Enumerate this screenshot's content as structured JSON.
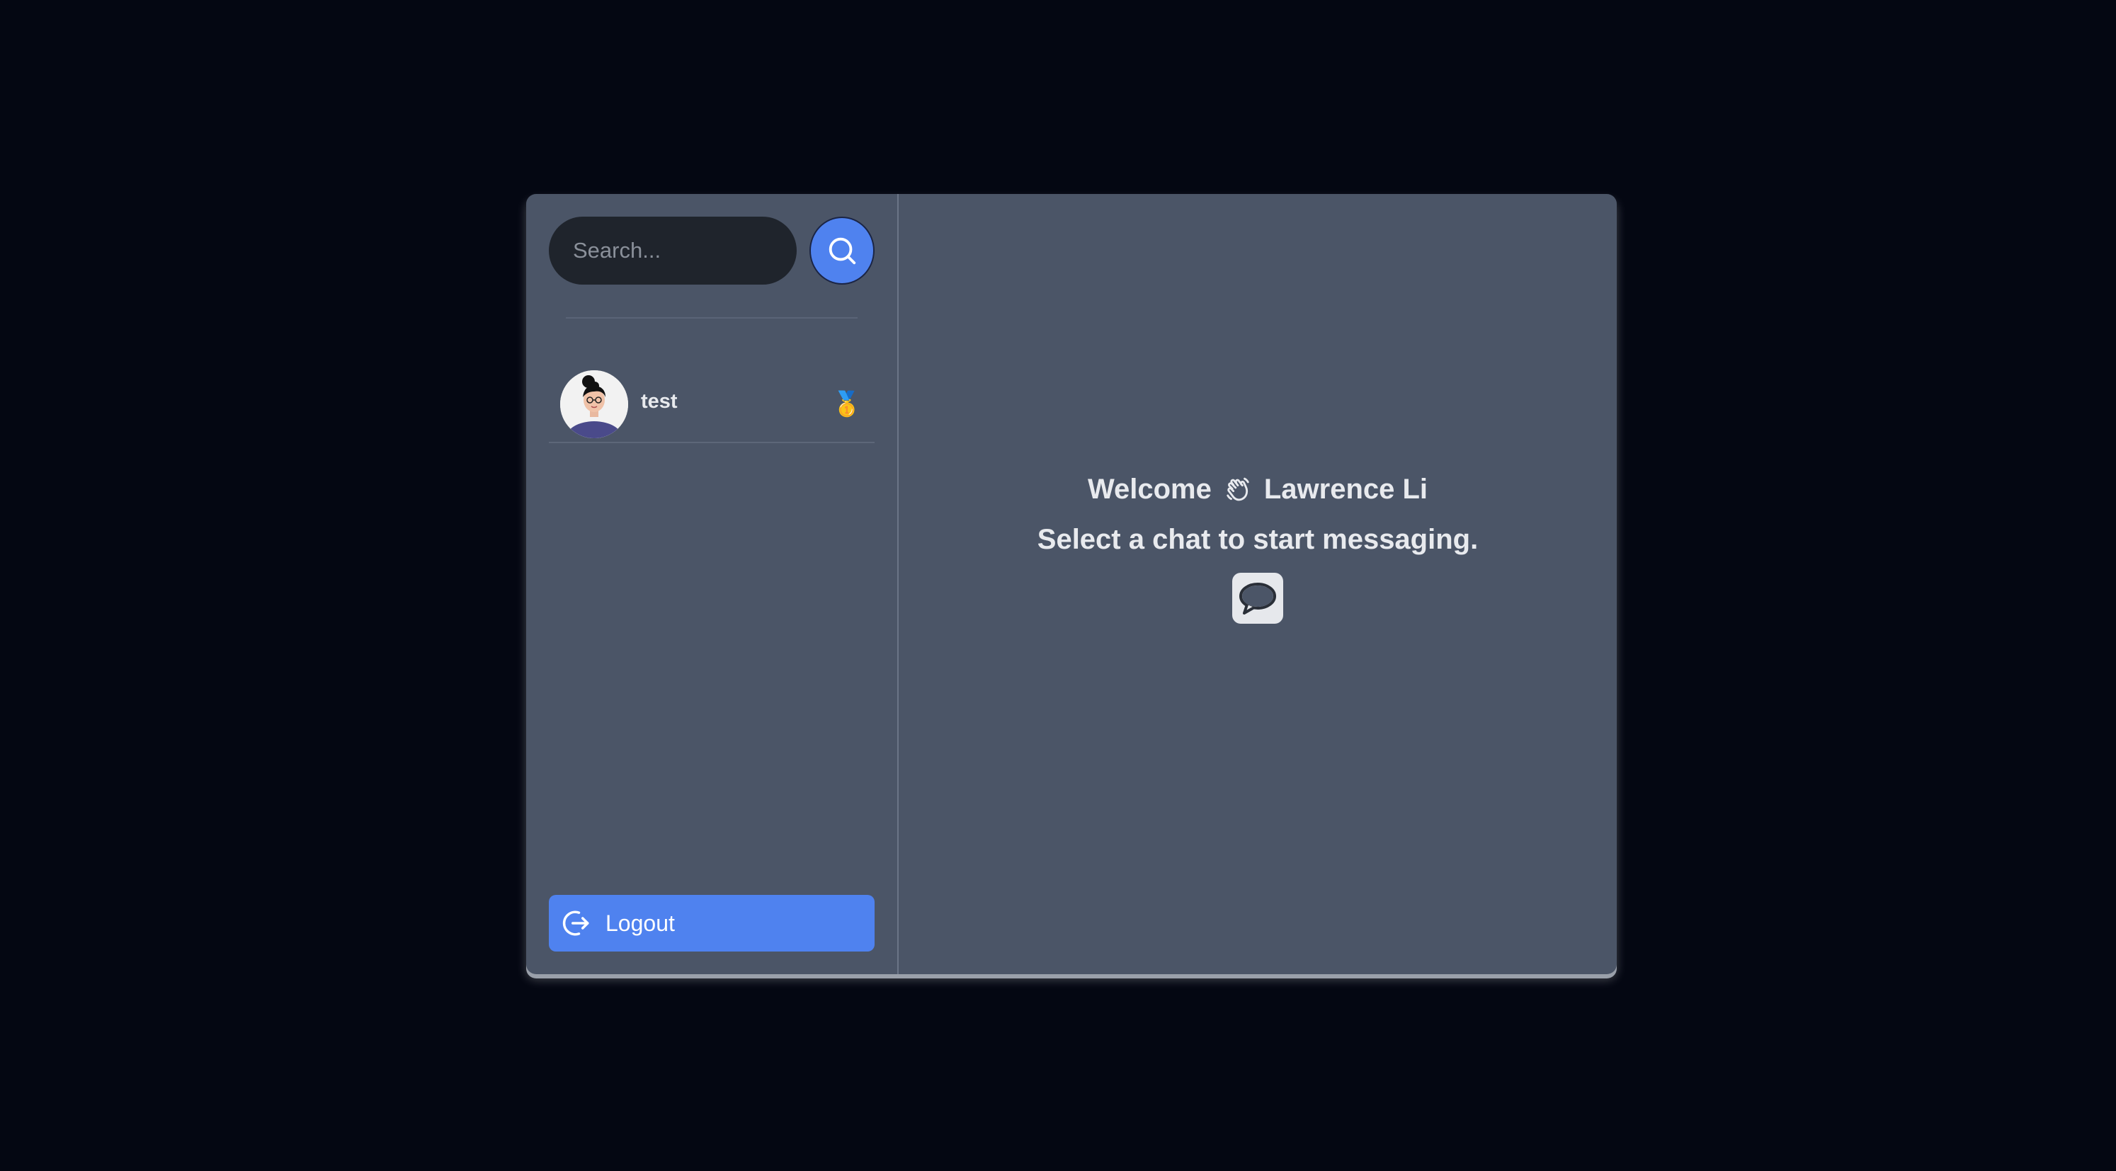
{
  "sidebar": {
    "search": {
      "placeholder": "Search..."
    },
    "conversations": [
      {
        "name": "test",
        "emoji": "🥇",
        "avatar": "avatar-illustration"
      }
    ],
    "logout_label": "Logout"
  },
  "main": {
    "welcome_prefix": "Welcome",
    "user_name": "Lawrence Li",
    "subtitle": "Select a chat to start messaging."
  },
  "colors": {
    "background": "#040712",
    "panel": "#4b5567",
    "accent": "#4f82ef",
    "search_bg": "#1f242c"
  }
}
